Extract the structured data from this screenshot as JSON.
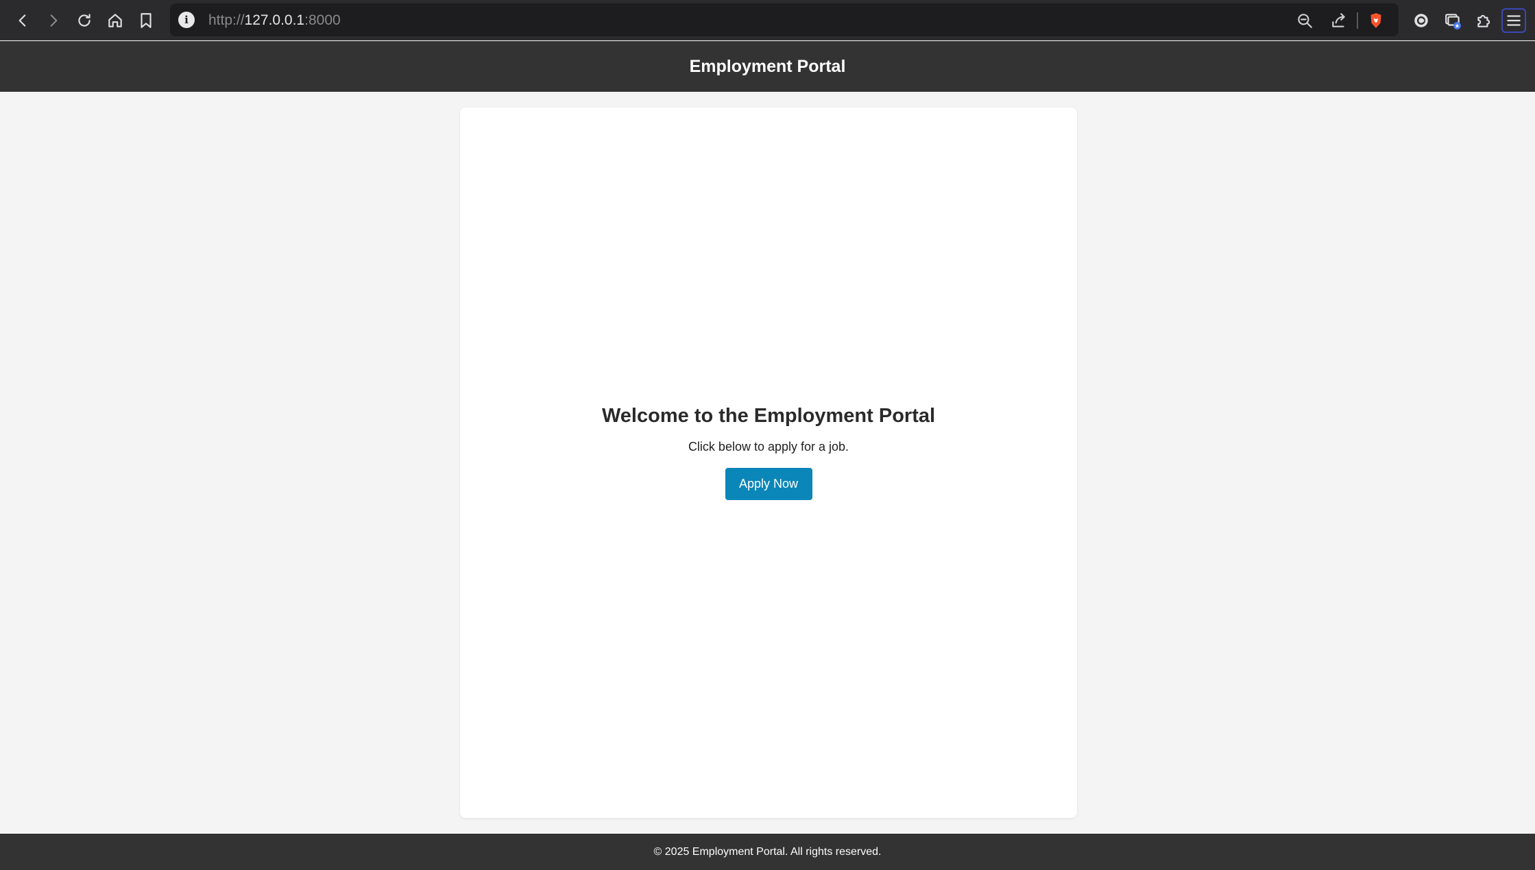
{
  "browser": {
    "url_scheme": "http://",
    "url_host": "127.0.0.1",
    "url_port": ":8000",
    "info_glyph": "i",
    "icons": [
      "back-icon",
      "forward-icon",
      "reload-icon",
      "home-icon",
      "bookmark-icon",
      "zoom-out-icon",
      "share-icon",
      "brave-shield-icon",
      "leo-ai-icon",
      "wallet-icon",
      "extensions-icon",
      "menu-icon"
    ],
    "colors": {
      "chrome_bg": "#2b2b2e",
      "urlbar_bg": "#1d1d20",
      "shield": "#fb542b"
    }
  },
  "header": {
    "title": "Employment Portal"
  },
  "main": {
    "heading": "Welcome to the Employment Portal",
    "subtext": "Click below to apply for a job.",
    "apply_label": "Apply Now"
  },
  "footer": {
    "text": "© 2025 Employment Portal. All rights reserved."
  },
  "colors": {
    "header_bg": "#333333",
    "page_bg": "#f4f4f4",
    "button_bg": "#0a86b8"
  }
}
